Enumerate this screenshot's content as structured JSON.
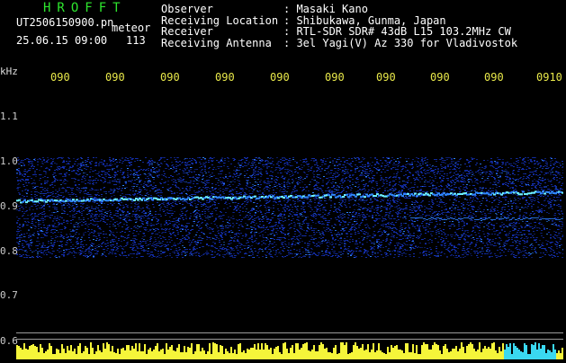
{
  "header": {
    "title": "HROFFT",
    "file_name": "UT2506150900.pn",
    "meteor_label": "meteor",
    "datetime": "25.06.15 09:00",
    "meteor_count": "113",
    "info": [
      {
        "key": "Observer",
        "value": ": Masaki Kano"
      },
      {
        "key": "Receiving Location",
        "value": ": Shibukawa, Gunma, Japan"
      },
      {
        "key": "Receiver",
        "value": ": RTL-SDR SDR# 43dB L15 103.2MHz CW"
      },
      {
        "key": "Receiving Antenna",
        "value": ": 3el Yagi(V) Az 330 for Vladivostok"
      }
    ]
  },
  "axis": {
    "unit": "kHz",
    "y_ticks": [
      "1.1",
      "1.0",
      "0.9",
      "0.8",
      "0.7",
      "0.6"
    ],
    "time_ticks": [
      "090",
      "090",
      "090",
      "090",
      "090",
      "090",
      "090",
      "090",
      "090",
      "0910"
    ]
  },
  "colors": {
    "title": "#2ee62e",
    "time_ticks": "#e8e84a",
    "signal_low": "#1430b4",
    "signal_mid": "#2f86ff",
    "signal_high": "#6cf0ff",
    "bar_yellow": "#f5f53a",
    "bar_cyan": "#3ad8f0"
  }
}
